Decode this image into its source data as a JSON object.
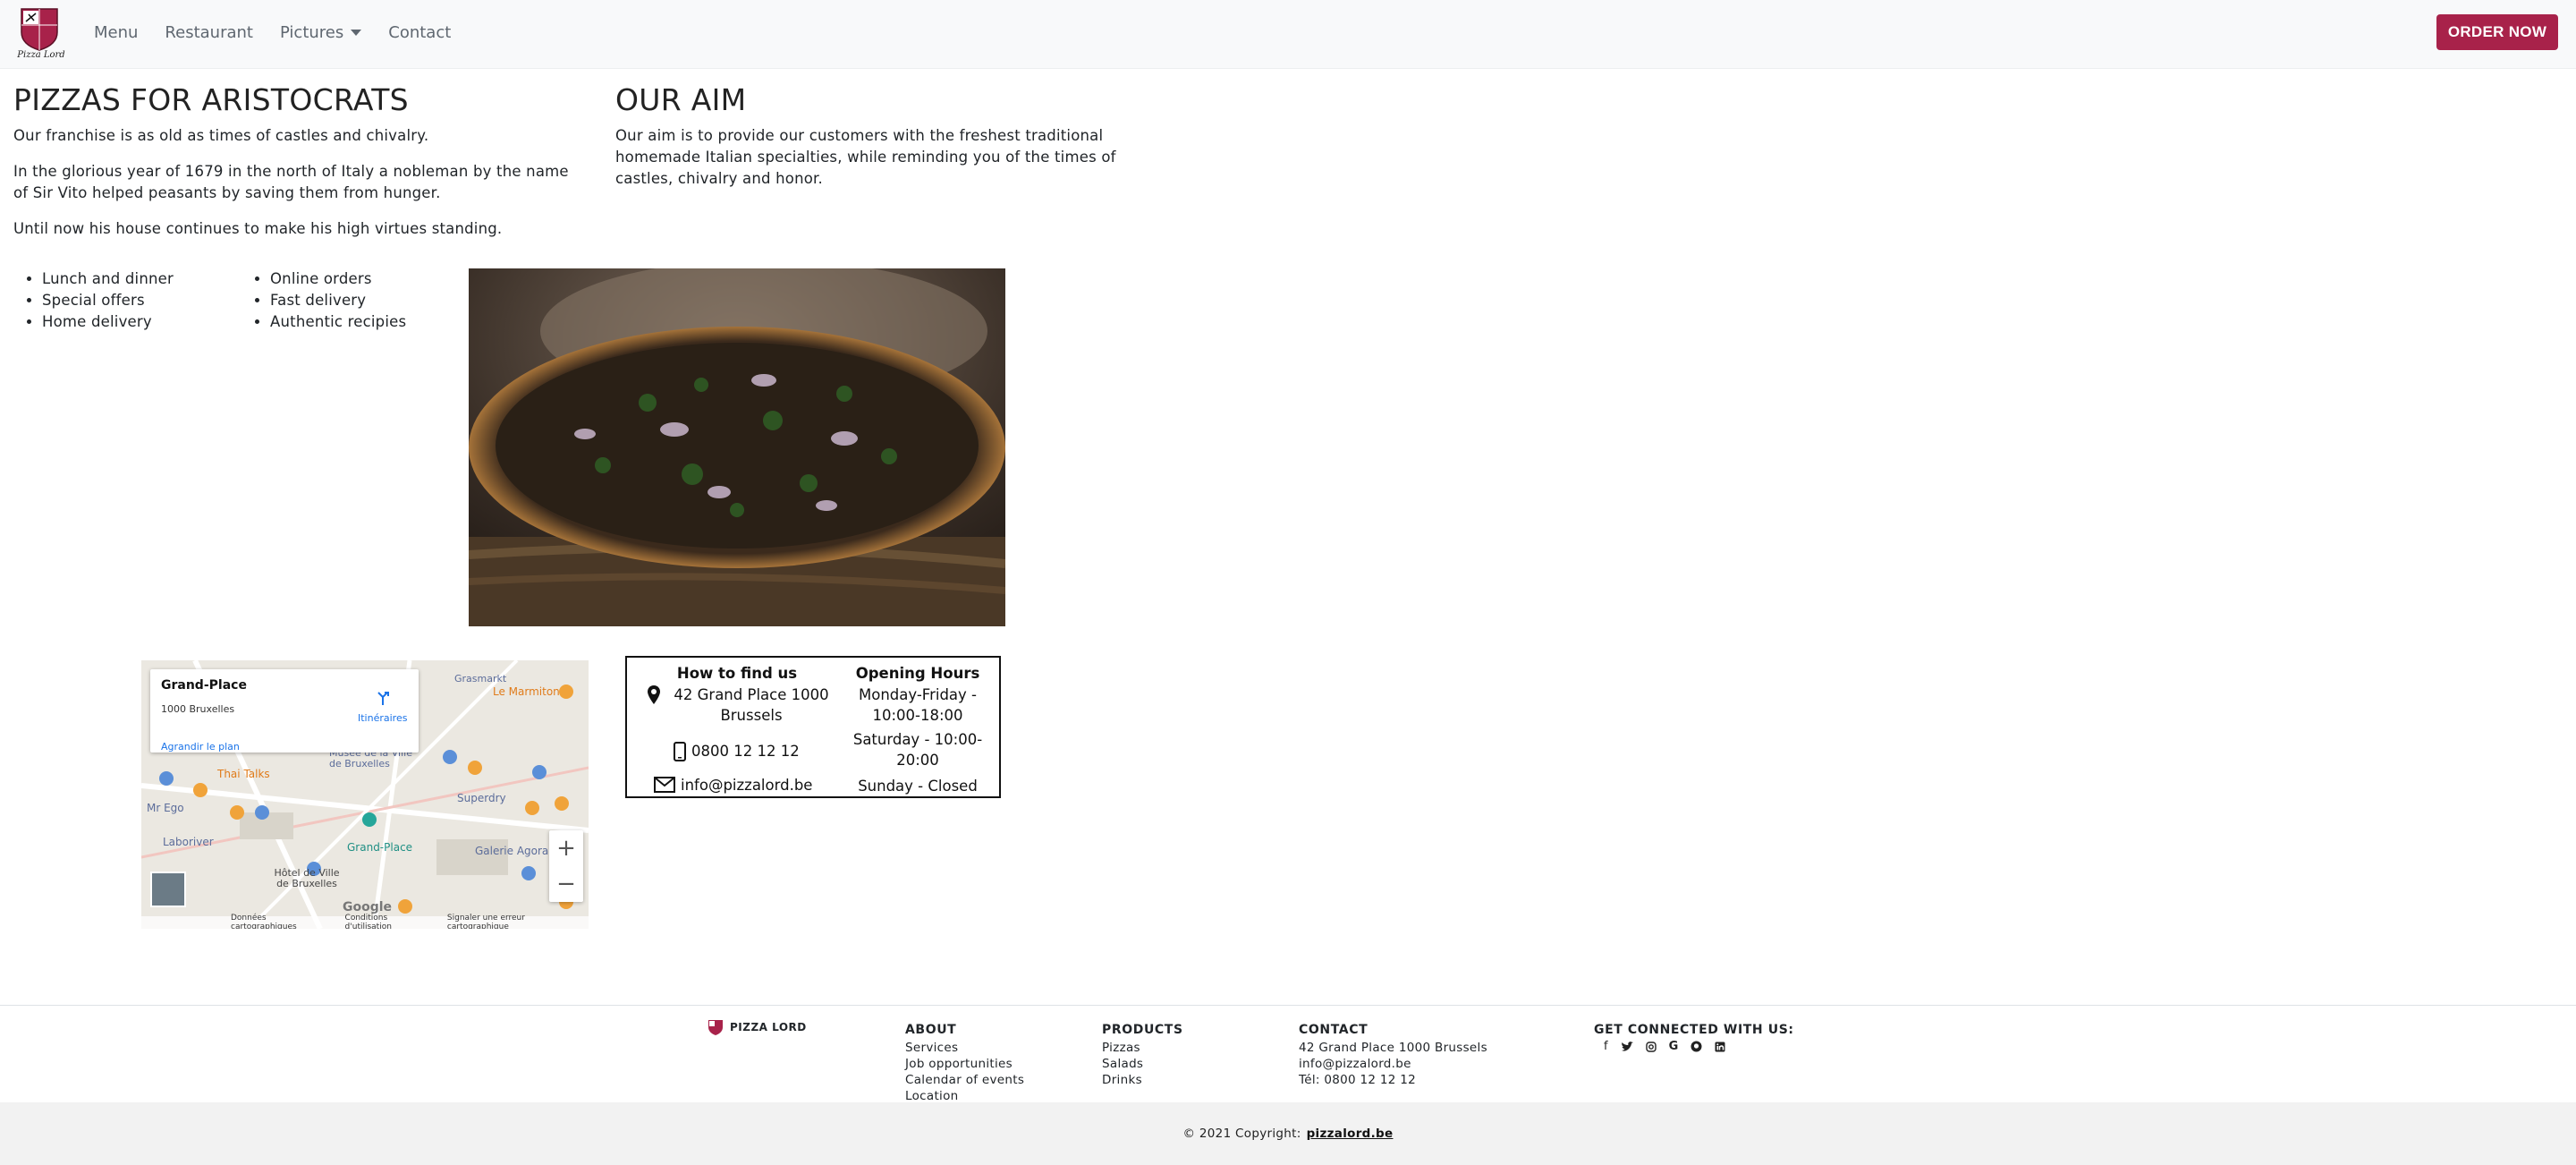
{
  "nav": {
    "logo_text": "Pizza Lord",
    "items": [
      "Menu",
      "Restaurant",
      "Pictures",
      "Contact"
    ],
    "order_button": "ORDER NOW"
  },
  "intro": {
    "title": "PIZZAS FOR ARISTOCRATS",
    "p1": "Our franchise is as old as times of castles and chivalry.",
    "p2": "In the glorious year of 1679 in the north of Italy a nobleman by the name of Sir Vito helped peasants by saving them from hunger.",
    "p3": "Until now his house continues to make his high virtues standing."
  },
  "aim": {
    "title": "OUR AIM",
    "text": "Our aim is to provide our customers with the freshest traditional homemade Italian specialties, while reminding you of the times of castles, chivalry and honor."
  },
  "features": {
    "col1": [
      "Lunch and dinner",
      "Special offers",
      "Home delivery"
    ],
    "col2": [
      "Online orders",
      "Fast delivery",
      "Authentic recipies"
    ]
  },
  "map": {
    "place": "Grand-Place",
    "address": "1000 Bruxelles",
    "enlarge": "Agrandir le plan",
    "directions": "Itinéraires",
    "labels": [
      "Thai Talks",
      "Mr Ego",
      "Laboriver",
      "Grand-Place",
      "Hôtel de Ville de Bruxelles",
      "Le Marmiton",
      "Superdry",
      "Galerie Agora",
      "Musée de la Ville de Bruxelles",
      "Grasmarkt"
    ],
    "footer": [
      "Données cartographiques",
      "Conditions d'utilisation",
      "Signaler une erreur cartographique"
    ]
  },
  "info": {
    "find_title": "How to find us",
    "hours_title": "Opening Hours",
    "address": "42 Grand Place 1000 Brussels",
    "phone": "0800 12 12 12",
    "email": "info@pizzalord.be",
    "hours1": "Monday-Friday - 10:00-18:00",
    "hours2": "Saturday - 10:00-20:00",
    "hours3": "Sunday - Closed"
  },
  "footer": {
    "brand": "PIZZA LORD",
    "about_title": "ABOUT",
    "about": [
      "Services",
      "Job opportunities",
      "Calendar of events",
      "Location"
    ],
    "products_title": "PRODUCTS",
    "products": [
      "Pizzas",
      "Salads",
      "Drinks"
    ],
    "contact_title": "CONTACT",
    "contact": [
      "42 Grand Place 1000 Brussels",
      "info@pizzalord.be",
      "Tél: 0800 12 12 12"
    ],
    "social_title": "GET CONNECTED WITH US:",
    "social_icons": [
      "facebook-icon",
      "twitter-icon",
      "instagram-icon",
      "google-icon",
      "github-icon",
      "linkedin-icon"
    ],
    "copyright": "© 2021 Copyright:",
    "copyright_link": "pizzalord.be"
  },
  "colors": {
    "accent": "#a8224a",
    "navbar_bg": "#f8f9fa",
    "copyright_bg": "#f2f2f2"
  }
}
